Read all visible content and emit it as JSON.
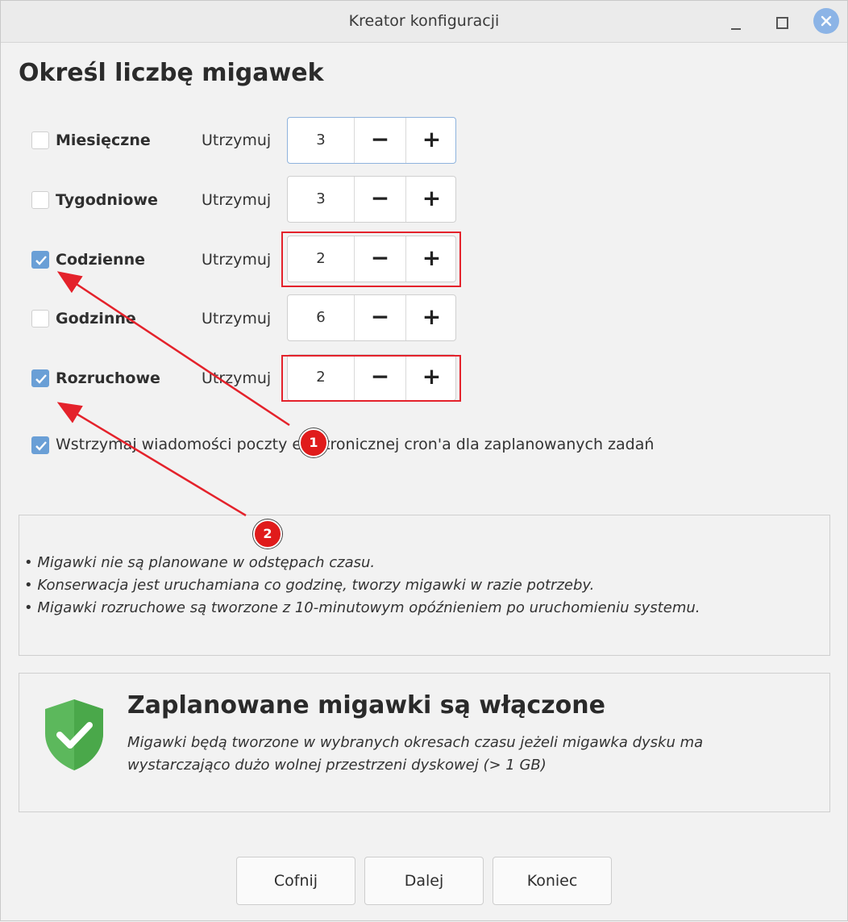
{
  "window": {
    "title": "Kreator konfiguracji"
  },
  "heading": "Określ liczbę migawek",
  "rows": [
    {
      "label": "Miesięczne",
      "checked": false,
      "keep_label": "Utrzymuj",
      "value": "3",
      "dec": "−",
      "inc": "+"
    },
    {
      "label": "Tygodniowe",
      "checked": false,
      "keep_label": "Utrzymuj",
      "value": "3",
      "dec": "−",
      "inc": "+"
    },
    {
      "label": "Codzienne",
      "checked": true,
      "keep_label": "Utrzymuj",
      "value": "2",
      "dec": "−",
      "inc": "+"
    },
    {
      "label": "Godzinne",
      "checked": false,
      "keep_label": "Utrzymuj",
      "value": "6",
      "dec": "−",
      "inc": "+"
    },
    {
      "label": "Rozruchowe",
      "checked": true,
      "keep_label": "Utrzymuj",
      "value": "2",
      "dec": "−",
      "inc": "+"
    }
  ],
  "suppress": {
    "label": "Wstrzymaj wiadomości poczty elektronicznej cron'a dla zaplanowanych zadań",
    "checked": true
  },
  "info_lines": [
    "• Migawki nie są planowane w odstępach czasu.",
    "• Konserwacja jest uruchamiana co godzinę, tworzy migawki w razie potrzeby.",
    "• Migawki rozruchowe są tworzone z 10-minutowym opóźnieniem po uruchomieniu systemu."
  ],
  "status": {
    "title": "Zaplanowane migawki są włączone",
    "desc_line1": "Migawki będą tworzone w wybranych okresach czasu jeżeli migawka dysku ma",
    "desc_line2": "wystarczająco dużo wolnej przestrzeni dyskowej (> 1 GB)",
    "icon": "shield-check-icon",
    "color": "#5cb85c"
  },
  "buttons": {
    "back": "Cofnij",
    "next": "Dalej",
    "finish": "Koniec"
  },
  "annotations": {
    "badge1": "1",
    "badge2": "2",
    "color": "#e4222b"
  },
  "colors": {
    "checkbox_checked": "#6a9fd6",
    "window_bg": "#f2f2f2"
  }
}
